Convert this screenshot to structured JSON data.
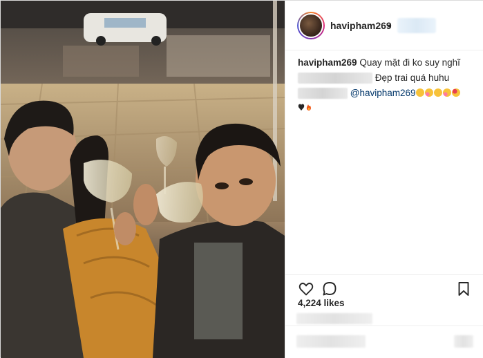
{
  "post": {
    "author": "havipham269",
    "separator": "•",
    "caption": {
      "user": "havipham269",
      "text": "Quay mặt đi ko suy nghĩ"
    },
    "comments": [
      {
        "text": "Đẹp trai quá huhu"
      },
      {
        "mention": "@havipham269"
      }
    ],
    "likes": "4,224 likes",
    "icons": {
      "like": "heart-icon",
      "comment": "comment-bubble-icon",
      "save": "bookmark-icon"
    },
    "colors": {
      "mention": "#003569",
      "text": "#262626",
      "border": "#dbdbdb"
    }
  }
}
